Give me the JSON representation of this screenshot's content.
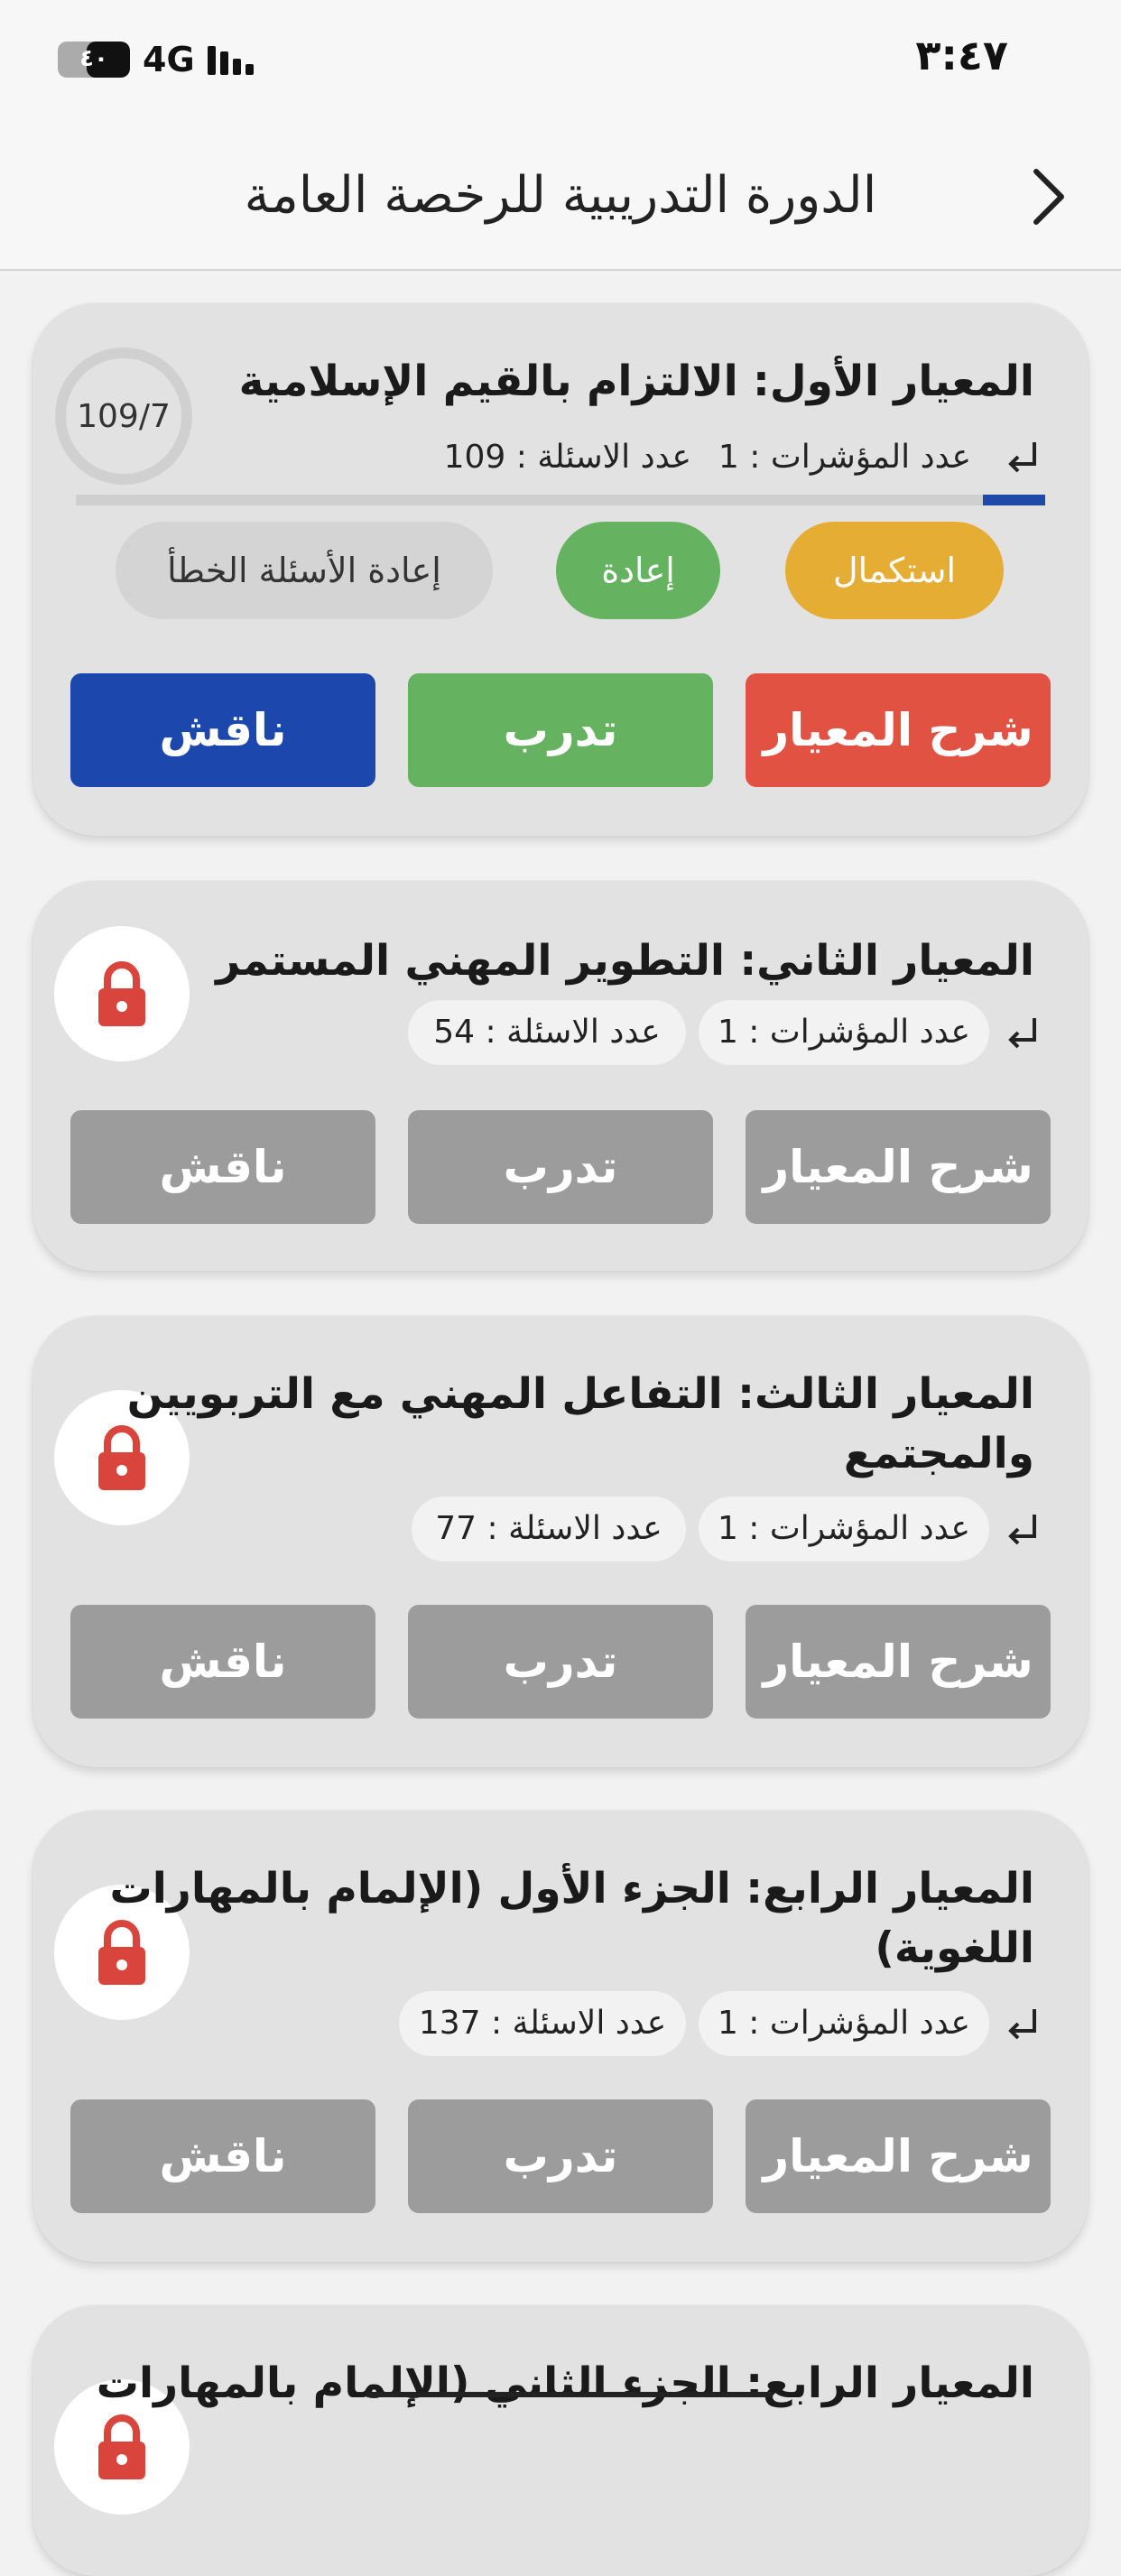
{
  "status_bar": {
    "time": "٣:٤٧",
    "battery": "٤٠",
    "network": "4G"
  },
  "header": {
    "title": "الدورة التدريبية للرخصة العامة"
  },
  "cards": [
    {
      "title_lines": [
        "المعيار الأول: الالتزام بالقيم الإسلامية"
      ],
      "indicators": "عدد المؤشرات : 1",
      "questions": "عدد الاسئلة : 109",
      "progress_label": "109/7",
      "progress_fraction": 0.064,
      "actions": {
        "complete": "استكمال",
        "repeat": "إعادة",
        "retry_wrong": "إعادة الأسئلة الخطأ"
      },
      "buttons": {
        "explain": "شرح المعيار",
        "train": "تدرب",
        "discuss": "ناقش"
      },
      "locked": false
    },
    {
      "title_lines": [
        "المعيار الثاني: التطوير المهني المستمر"
      ],
      "indicators": "عدد المؤشرات : 1",
      "questions": "عدد الاسئلة : 54",
      "buttons": {
        "explain": "شرح المعيار",
        "train": "تدرب",
        "discuss": "ناقش"
      },
      "locked": true
    },
    {
      "title_lines": [
        "المعيار الثالث: التفاعل المهني مع التربويين",
        "والمجتمع"
      ],
      "indicators": "عدد المؤشرات : 1",
      "questions": "عدد الاسئلة : 77",
      "buttons": {
        "explain": "شرح المعيار",
        "train": "تدرب",
        "discuss": "ناقش"
      },
      "locked": true
    },
    {
      "title_lines": [
        "المعيار الرابع: الجزء الأول (الإلمام بالمهارات",
        "اللغوية)"
      ],
      "indicators": "عدد المؤشرات : 1",
      "questions": "عدد الاسئلة : 137",
      "buttons": {
        "explain": "شرح المعيار",
        "train": "تدرب",
        "discuss": "ناقش"
      },
      "locked": true
    },
    {
      "title_lines": [
        "المعيار الرابع: الجزء الثاني (الإلمام بالمهارات"
      ],
      "locked": true
    }
  ],
  "colors": {
    "red": "#e15243",
    "green": "#65b360",
    "blue": "#1c47ad",
    "orange": "#e6ad35",
    "grey": "#9c9c9c",
    "lock": "#d9453c"
  }
}
